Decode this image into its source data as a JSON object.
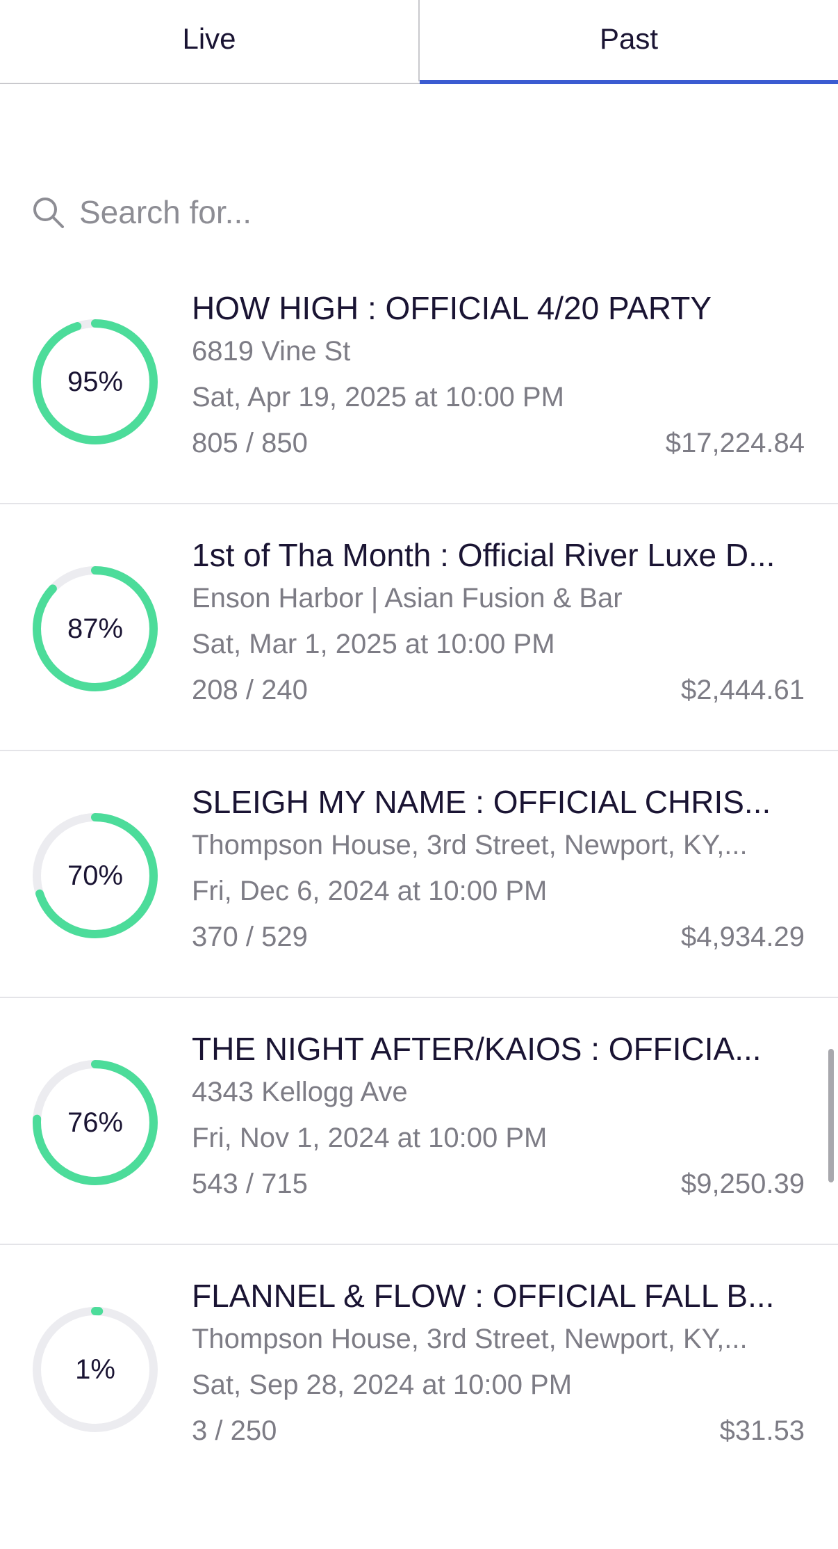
{
  "tabs": [
    {
      "label": "Live",
      "active": false
    },
    {
      "label": "Past",
      "active": true
    }
  ],
  "search": {
    "placeholder": "Search for..."
  },
  "colors": {
    "accent": "#3b5bd1",
    "progress": "#4cdc9a",
    "track": "#ececf0"
  },
  "events": [
    {
      "percent_label": "95%",
      "percent": 95,
      "title": "HOW HIGH : OFFICIAL 4/20 PARTY",
      "venue": "6819 Vine St",
      "date": "Sat, Apr 19, 2025 at 10:00 PM",
      "tickets": "805 / 850",
      "revenue": "$17,224.84"
    },
    {
      "percent_label": "87%",
      "percent": 87,
      "title": "1st of Tha Month : Official River Luxe D...",
      "venue": "Enson Harbor | Asian Fusion & Bar",
      "date": "Sat, Mar 1, 2025 at 10:00 PM",
      "tickets": "208 / 240",
      "revenue": "$2,444.61"
    },
    {
      "percent_label": "70%",
      "percent": 70,
      "title": "SLEIGH MY NAME : OFFICIAL CHRIS...",
      "venue": "Thompson House, 3rd Street, Newport, KY,...",
      "date": "Fri, Dec 6, 2024 at 10:00 PM",
      "tickets": "370 / 529",
      "revenue": "$4,934.29"
    },
    {
      "percent_label": "76%",
      "percent": 76,
      "title": "THE NIGHT AFTER/KAIOS : OFFICIA...",
      "venue": "4343 Kellogg Ave",
      "date": "Fri, Nov 1, 2024 at 10:00 PM",
      "tickets": "543 / 715",
      "revenue": "$9,250.39"
    },
    {
      "percent_label": "1%",
      "percent": 1,
      "title": "FLANNEL & FLOW : OFFICIAL FALL B...",
      "venue": "Thompson House, 3rd Street, Newport, KY,...",
      "date": "Sat, Sep 28, 2024 at 10:00 PM",
      "tickets": "3 / 250",
      "revenue": "$31.53"
    }
  ]
}
